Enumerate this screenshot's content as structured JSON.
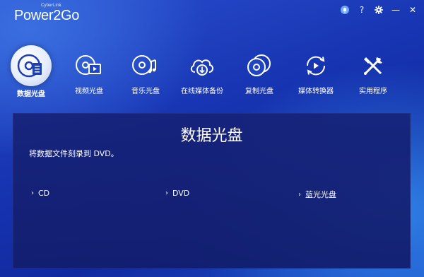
{
  "brand": {
    "small": "CyberLink",
    "main": "Power2Go"
  },
  "window": {
    "buttons": [
      "bell-icon",
      "help-icon",
      "gear-icon",
      "minimize-icon",
      "close-icon"
    ],
    "help": "?",
    "minimize": "—",
    "close": "✕"
  },
  "nav": {
    "items": [
      {
        "label": "数据光盘",
        "icon": "data-disc-icon",
        "active": true
      },
      {
        "label": "视频光盘",
        "icon": "video-disc-icon"
      },
      {
        "label": "音乐光盘",
        "icon": "music-disc-icon"
      },
      {
        "label": "在线媒体备份",
        "icon": "cloud-backup-icon"
      },
      {
        "label": "复制光盘",
        "icon": "copy-disc-icon"
      },
      {
        "label": "媒体转换器",
        "icon": "media-converter-icon"
      },
      {
        "label": "实用程序",
        "icon": "utilities-icon"
      }
    ]
  },
  "panel": {
    "title": "数据光盘",
    "description": "将数据文件刻录到 DVD。",
    "options": [
      {
        "label": "CD"
      },
      {
        "label": "DVD"
      },
      {
        "label": "蓝光光盘"
      }
    ],
    "chevron": "›"
  },
  "colors": {
    "background": "#1a3bb8",
    "panel": "#16227a",
    "active_icon_bg": "#e6eefc"
  }
}
